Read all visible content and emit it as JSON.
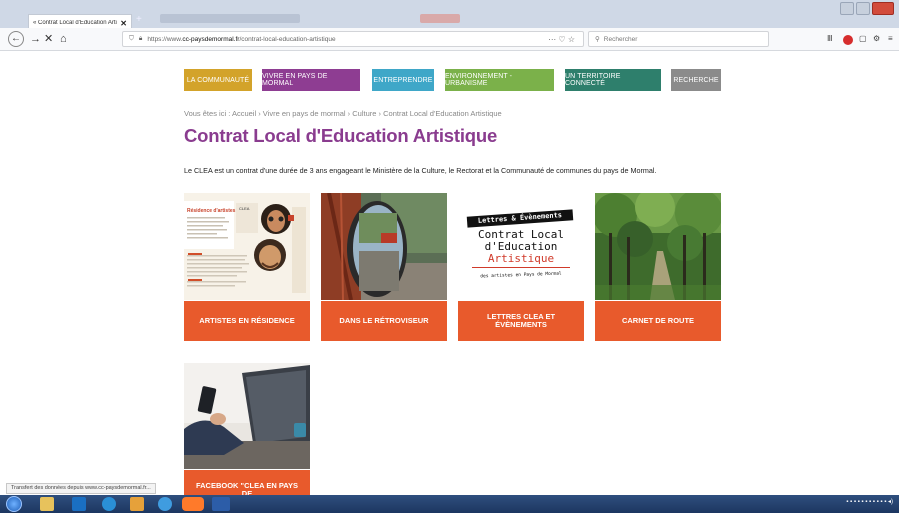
{
  "browser": {
    "tab_title": "« Contrat Local d'Education Artis",
    "tab_close": "✕",
    "new_tab": "+",
    "url_prefix": "https://www.",
    "url_domain": "cc-paysdemormal.fr",
    "url_path": "/contrat-local-education-artistique",
    "url_actions": "··· ♡ ☆",
    "search_placeholder": "Rechercher",
    "status_text": "Transfert des données depuis www.cc-paysdemormal.fr..."
  },
  "menu": [
    {
      "label": "La Communauté",
      "color": "#d3a32a"
    },
    {
      "label": "Vivre en Pays de Mormal",
      "color": "#8e3d92"
    },
    {
      "label": "Entreprendre",
      "color": "#3fa7c8"
    },
    {
      "label": "Environnement - Urbanisme",
      "color": "#7bb14a"
    },
    {
      "label": "Un Territoire Connecté",
      "color": "#2e7f6c"
    },
    {
      "label": "Recherche",
      "color": "#8b8b8b"
    }
  ],
  "breadcrumb": "Vous êtes ici : Accueil › Vivre en pays de mormal › Culture › Contrat Local d'Education Artistique",
  "page_title": "Contrat Local d'Education Artistique",
  "intro": "Le CLEA est un contrat d'une durée de 3 ans engageant le Ministère de la Culture, le Rectorat et la Communauté de communes du pays de Mormal.",
  "cards": [
    {
      "label": "Artistes en résidence"
    },
    {
      "label": "Dans le rétroviseur"
    },
    {
      "label": "Lettres CLEA et évènements"
    },
    {
      "label": "Carnet de route"
    },
    {
      "label": "Facebook \"CLEA en pays de"
    }
  ],
  "clea_poster": {
    "banner": "Lettres & Évènements",
    "line1": "Contrat Local",
    "line2": "d'Education",
    "line3": "Artistique",
    "caption": "des artistes en Pays de Mormal"
  },
  "brochure": {
    "heading": "Résidence d'artistes",
    "tag": "CLEA"
  },
  "colors": {
    "title": "#8a3c8f",
    "card_button": "#e85a2c"
  }
}
